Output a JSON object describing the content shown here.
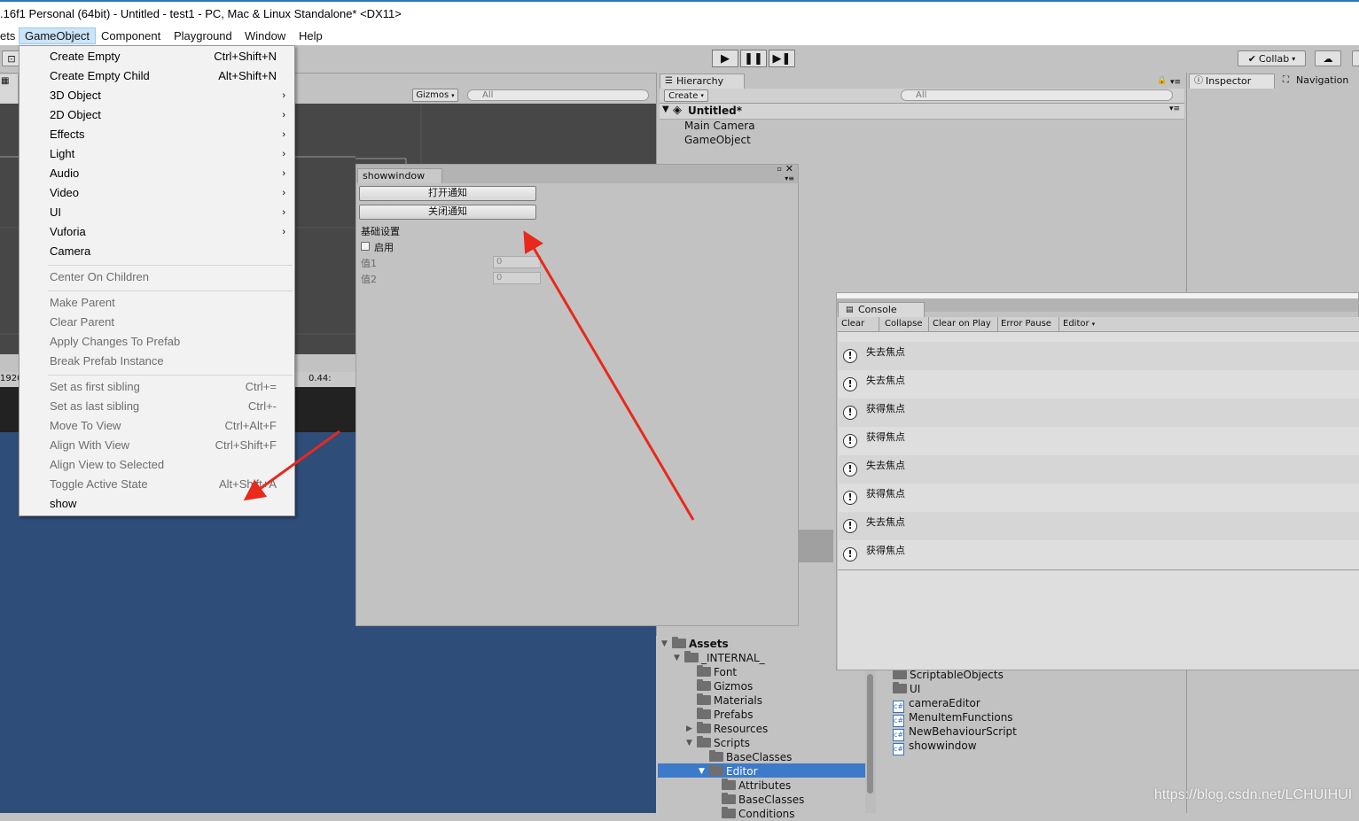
{
  "window_title": ".16f1 Personal (64bit) - Untitled - test1 - PC, Mac & Linux Standalone* <DX11>",
  "menubar": [
    "ets",
    "GameObject",
    "Component",
    "Playground",
    "Window",
    "Help"
  ],
  "toolbar": {
    "collab": "Collab",
    "scene_label": "1920",
    "gizmos": "Gizmos",
    "search_all": "All",
    "scale": "0.44:"
  },
  "menu": {
    "group1": [
      {
        "label": "Create Empty",
        "shortcut": "Ctrl+Shift+N"
      },
      {
        "label": "Create Empty Child",
        "shortcut": "Alt+Shift+N"
      },
      {
        "label": "3D Object",
        "arrow": "›"
      },
      {
        "label": "2D Object",
        "arrow": "›"
      },
      {
        "label": "Effects",
        "arrow": "›"
      },
      {
        "label": "Light",
        "arrow": "›"
      },
      {
        "label": "Audio",
        "arrow": "›"
      },
      {
        "label": "Video",
        "arrow": "›"
      },
      {
        "label": "UI",
        "arrow": "›"
      },
      {
        "label": "Vuforia",
        "arrow": "›"
      },
      {
        "label": "Camera"
      }
    ],
    "group2": [
      {
        "label": "Center On Children"
      }
    ],
    "group3": [
      {
        "label": "Make Parent"
      },
      {
        "label": "Clear Parent"
      },
      {
        "label": "Apply Changes To Prefab"
      },
      {
        "label": "Break Prefab Instance"
      }
    ],
    "group4": [
      {
        "label": "Set as first sibling",
        "shortcut": "Ctrl+="
      },
      {
        "label": "Set as last sibling",
        "shortcut": "Ctrl+-"
      },
      {
        "label": "Move To View",
        "shortcut": "Ctrl+Alt+F"
      },
      {
        "label": "Align With View",
        "shortcut": "Ctrl+Shift+F"
      },
      {
        "label": "Align View to Selected"
      },
      {
        "label": "Toggle Active State",
        "shortcut": "Alt+Shift+A"
      },
      {
        "label": "show"
      }
    ]
  },
  "showwindow": {
    "tab": "showwindow",
    "open_btn": "打开通知",
    "close_btn": "关闭通知",
    "section": "基础设置",
    "enable_label": "启用",
    "value1_label": "值1",
    "value1": "0",
    "value2_label": "值2",
    "value2": "0"
  },
  "hierarchy": {
    "tab": "Hierarchy",
    "create": "Create",
    "search": "All",
    "scene": "Untitled*",
    "items": [
      "Main Camera",
      "GameObject"
    ]
  },
  "inspector": {
    "tab": "Inspector",
    "nav_tab": "Navigation"
  },
  "console": {
    "tab": "Console",
    "buttons": [
      "Clear",
      "Collapse",
      "Clear on Play",
      "Error Pause",
      "Editor"
    ],
    "messages": [
      "失去焦点",
      "失去焦点",
      "获得焦点",
      "获得焦点",
      "失去焦点",
      "获得焦点",
      "失去焦点",
      "获得焦点"
    ]
  },
  "project": {
    "tree": [
      {
        "label": "Assets",
        "level": 0,
        "expanded": true,
        "bold": true
      },
      {
        "label": "_INTERNAL_",
        "level": 1,
        "expanded": true
      },
      {
        "label": "Font",
        "level": 2
      },
      {
        "label": "Gizmos",
        "level": 2
      },
      {
        "label": "Materials",
        "level": 2
      },
      {
        "label": "Prefabs",
        "level": 2
      },
      {
        "label": "Resources",
        "level": 2,
        "collapsed": true
      },
      {
        "label": "Scripts",
        "level": 2,
        "expanded": true
      },
      {
        "label": "BaseClasses",
        "level": 3
      },
      {
        "label": "Editor",
        "level": 3,
        "expanded": true,
        "selected": true
      },
      {
        "label": "Attributes",
        "level": 4
      },
      {
        "label": "BaseClasses",
        "level": 4
      },
      {
        "label": "Conditions",
        "level": 4
      }
    ],
    "files": [
      {
        "label": "ScriptableObjects",
        "type": "folder"
      },
      {
        "label": "UI",
        "type": "folder"
      },
      {
        "label": "cameraEditor",
        "type": "script"
      },
      {
        "label": "MenuItemFunctions",
        "type": "script"
      },
      {
        "label": "NewBehaviourScript",
        "type": "script"
      },
      {
        "label": "showwindow",
        "type": "script"
      }
    ]
  },
  "watermark": "https://blog.csdn.net/LCHUIHUI",
  "colors": {
    "arrow": "#e8291c",
    "game_view": "#2f4d79",
    "scene_bg": "#474747",
    "selected": "#3d7ac9"
  }
}
